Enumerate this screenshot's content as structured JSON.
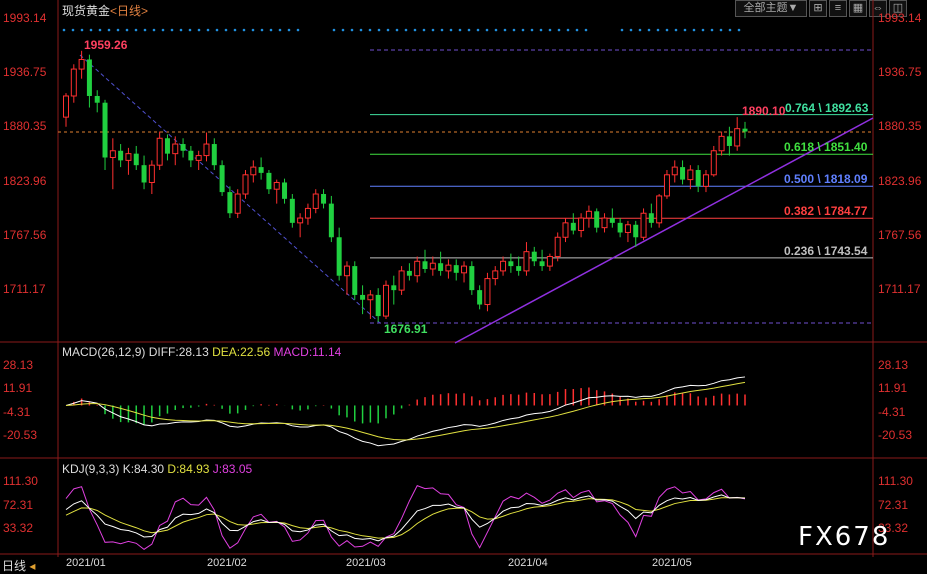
{
  "header": {
    "instrument": "现货黄金",
    "period": "<日线>",
    "theme_button": "全部主题",
    "theme_arrow": "▼",
    "icon_labels": [
      "⊞",
      "≡",
      "▦",
      "⇔",
      "◫"
    ]
  },
  "price_axis": {
    "ticks": [
      "1993.14",
      "1936.75",
      "1880.35",
      "1823.96",
      "1767.56",
      "1711.17"
    ],
    "tick_values": [
      1993.14,
      1936.75,
      1880.35,
      1823.96,
      1767.56,
      1711.17
    ]
  },
  "annotations": {
    "high_label": "1959.26",
    "low_label": "1676.91",
    "recent_high_label": "1890.10"
  },
  "fib_levels": [
    {
      "ratio": "0.764",
      "value": "1892.63",
      "label": "0.764 \\ 1892.63",
      "color": "#40e0a0"
    },
    {
      "ratio": "0.618",
      "value": "1851.40",
      "label": "0.618 \\ 1851.40",
      "color": "#40e040"
    },
    {
      "ratio": "0.500",
      "value": "1818.09",
      "label": "0.500 \\ 1818.09",
      "color": "#6080ff"
    },
    {
      "ratio": "0.382",
      "value": "1784.77",
      "label": "0.382 \\ 1784.77",
      "color": "#ff4040"
    },
    {
      "ratio": "0.236",
      "value": "1743.54",
      "label": "0.236 \\ 1743.54",
      "color": "#c0c0c0"
    }
  ],
  "macd": {
    "label": "MACD(26,12,9)",
    "diff": "DIFF:28.13",
    "dea": "DEA:22.56",
    "macd": "MACD:11.14",
    "ticks": [
      "28.13",
      "11.91",
      "-4.31",
      "-20.53"
    ]
  },
  "kdj": {
    "label": "KDJ(9,3,3)",
    "k": "K:84.30",
    "d": "D:84.93",
    "j": "J:83.05",
    "ticks": [
      "111.30",
      "72.31",
      "33.32"
    ]
  },
  "x_axis": {
    "period_label": "日线",
    "ticks": [
      "2021/01",
      "2021/02",
      "2021/03",
      "2021/04",
      "2021/05"
    ]
  },
  "watermark": "FX678",
  "chart_data": {
    "type": "candlestick",
    "title": "现货黄金",
    "ylim": [
      1670,
      1995
    ],
    "candles": [
      {
        "o": 1890,
        "h": 1915,
        "l": 1880,
        "c": 1912
      },
      {
        "o": 1912,
        "h": 1945,
        "l": 1905,
        "c": 1940
      },
      {
        "o": 1940,
        "h": 1959,
        "l": 1930,
        "c": 1950
      },
      {
        "o": 1950,
        "h": 1955,
        "l": 1900,
        "c": 1912
      },
      {
        "o": 1912,
        "h": 1918,
        "l": 1895,
        "c": 1905
      },
      {
        "o": 1905,
        "h": 1908,
        "l": 1835,
        "c": 1848
      },
      {
        "o": 1848,
        "h": 1868,
        "l": 1815,
        "c": 1855
      },
      {
        "o": 1855,
        "h": 1862,
        "l": 1838,
        "c": 1845
      },
      {
        "o": 1845,
        "h": 1858,
        "l": 1830,
        "c": 1852
      },
      {
        "o": 1852,
        "h": 1860,
        "l": 1835,
        "c": 1840
      },
      {
        "o": 1840,
        "h": 1850,
        "l": 1815,
        "c": 1822
      },
      {
        "o": 1822,
        "h": 1845,
        "l": 1810,
        "c": 1840
      },
      {
        "o": 1840,
        "h": 1875,
        "l": 1835,
        "c": 1868
      },
      {
        "o": 1868,
        "h": 1872,
        "l": 1845,
        "c": 1852
      },
      {
        "o": 1852,
        "h": 1870,
        "l": 1840,
        "c": 1862
      },
      {
        "o": 1862,
        "h": 1868,
        "l": 1848,
        "c": 1855
      },
      {
        "o": 1855,
        "h": 1860,
        "l": 1838,
        "c": 1845
      },
      {
        "o": 1845,
        "h": 1855,
        "l": 1835,
        "c": 1850
      },
      {
        "o": 1850,
        "h": 1874,
        "l": 1844,
        "c": 1862
      },
      {
        "o": 1862,
        "h": 1868,
        "l": 1835,
        "c": 1840
      },
      {
        "o": 1840,
        "h": 1845,
        "l": 1808,
        "c": 1812
      },
      {
        "o": 1812,
        "h": 1818,
        "l": 1785,
        "c": 1790
      },
      {
        "o": 1790,
        "h": 1815,
        "l": 1785,
        "c": 1810
      },
      {
        "o": 1810,
        "h": 1835,
        "l": 1805,
        "c": 1830
      },
      {
        "o": 1830,
        "h": 1845,
        "l": 1822,
        "c": 1838
      },
      {
        "o": 1838,
        "h": 1848,
        "l": 1825,
        "c": 1832
      },
      {
        "o": 1832,
        "h": 1835,
        "l": 1810,
        "c": 1815
      },
      {
        "o": 1815,
        "h": 1825,
        "l": 1800,
        "c": 1822
      },
      {
        "o": 1822,
        "h": 1826,
        "l": 1800,
        "c": 1805
      },
      {
        "o": 1805,
        "h": 1810,
        "l": 1775,
        "c": 1780
      },
      {
        "o": 1780,
        "h": 1790,
        "l": 1765,
        "c": 1785
      },
      {
        "o": 1785,
        "h": 1800,
        "l": 1778,
        "c": 1795
      },
      {
        "o": 1795,
        "h": 1815,
        "l": 1790,
        "c": 1810
      },
      {
        "o": 1810,
        "h": 1815,
        "l": 1795,
        "c": 1800
      },
      {
        "o": 1800,
        "h": 1808,
        "l": 1760,
        "c": 1765
      },
      {
        "o": 1765,
        "h": 1775,
        "l": 1720,
        "c": 1725
      },
      {
        "o": 1725,
        "h": 1740,
        "l": 1705,
        "c": 1735
      },
      {
        "o": 1735,
        "h": 1740,
        "l": 1700,
        "c": 1705
      },
      {
        "o": 1705,
        "h": 1715,
        "l": 1685,
        "c": 1700
      },
      {
        "o": 1700,
        "h": 1710,
        "l": 1680,
        "c": 1705
      },
      {
        "o": 1705,
        "h": 1712,
        "l": 1677,
        "c": 1683
      },
      {
        "o": 1683,
        "h": 1720,
        "l": 1680,
        "c": 1715
      },
      {
        "o": 1715,
        "h": 1725,
        "l": 1695,
        "c": 1710
      },
      {
        "o": 1710,
        "h": 1735,
        "l": 1705,
        "c": 1730
      },
      {
        "o": 1730,
        "h": 1738,
        "l": 1720,
        "c": 1725
      },
      {
        "o": 1725,
        "h": 1745,
        "l": 1718,
        "c": 1740
      },
      {
        "o": 1740,
        "h": 1752,
        "l": 1728,
        "c": 1732
      },
      {
        "o": 1732,
        "h": 1745,
        "l": 1725,
        "c": 1738
      },
      {
        "o": 1738,
        "h": 1750,
        "l": 1725,
        "c": 1730
      },
      {
        "o": 1730,
        "h": 1742,
        "l": 1722,
        "c": 1736
      },
      {
        "o": 1736,
        "h": 1742,
        "l": 1720,
        "c": 1728
      },
      {
        "o": 1728,
        "h": 1740,
        "l": 1718,
        "c": 1735
      },
      {
        "o": 1735,
        "h": 1740,
        "l": 1705,
        "c": 1710
      },
      {
        "o": 1710,
        "h": 1715,
        "l": 1690,
        "c": 1695
      },
      {
        "o": 1695,
        "h": 1728,
        "l": 1688,
        "c": 1722
      },
      {
        "o": 1722,
        "h": 1735,
        "l": 1715,
        "c": 1730
      },
      {
        "o": 1730,
        "h": 1745,
        "l": 1725,
        "c": 1740
      },
      {
        "o": 1740,
        "h": 1748,
        "l": 1728,
        "c": 1735
      },
      {
        "o": 1735,
        "h": 1745,
        "l": 1725,
        "c": 1730
      },
      {
        "o": 1730,
        "h": 1760,
        "l": 1725,
        "c": 1750
      },
      {
        "o": 1750,
        "h": 1755,
        "l": 1735,
        "c": 1740
      },
      {
        "o": 1740,
        "h": 1752,
        "l": 1730,
        "c": 1735
      },
      {
        "o": 1735,
        "h": 1748,
        "l": 1730,
        "c": 1745
      },
      {
        "o": 1745,
        "h": 1770,
        "l": 1740,
        "c": 1765
      },
      {
        "o": 1765,
        "h": 1785,
        "l": 1760,
        "c": 1780
      },
      {
        "o": 1780,
        "h": 1790,
        "l": 1768,
        "c": 1772
      },
      {
        "o": 1772,
        "h": 1790,
        "l": 1765,
        "c": 1785
      },
      {
        "o": 1785,
        "h": 1798,
        "l": 1775,
        "c": 1792
      },
      {
        "o": 1792,
        "h": 1795,
        "l": 1770,
        "c": 1775
      },
      {
        "o": 1775,
        "h": 1790,
        "l": 1770,
        "c": 1785
      },
      {
        "o": 1785,
        "h": 1795,
        "l": 1775,
        "c": 1780
      },
      {
        "o": 1780,
        "h": 1785,
        "l": 1765,
        "c": 1770
      },
      {
        "o": 1770,
        "h": 1782,
        "l": 1760,
        "c": 1778
      },
      {
        "o": 1778,
        "h": 1782,
        "l": 1755,
        "c": 1765
      },
      {
        "o": 1765,
        "h": 1795,
        "l": 1762,
        "c": 1790
      },
      {
        "o": 1790,
        "h": 1800,
        "l": 1775,
        "c": 1780
      },
      {
        "o": 1780,
        "h": 1810,
        "l": 1775,
        "c": 1808
      },
      {
        "o": 1808,
        "h": 1835,
        "l": 1805,
        "c": 1830
      },
      {
        "o": 1830,
        "h": 1845,
        "l": 1822,
        "c": 1838
      },
      {
        "o": 1838,
        "h": 1845,
        "l": 1820,
        "c": 1825
      },
      {
        "o": 1825,
        "h": 1840,
        "l": 1815,
        "c": 1835
      },
      {
        "o": 1835,
        "h": 1840,
        "l": 1812,
        "c": 1818
      },
      {
        "o": 1818,
        "h": 1835,
        "l": 1812,
        "c": 1830
      },
      {
        "o": 1830,
        "h": 1860,
        "l": 1828,
        "c": 1855
      },
      {
        "o": 1855,
        "h": 1875,
        "l": 1850,
        "c": 1870
      },
      {
        "o": 1870,
        "h": 1880,
        "l": 1850,
        "c": 1860
      },
      {
        "o": 1860,
        "h": 1890,
        "l": 1855,
        "c": 1878
      },
      {
        "o": 1878,
        "h": 1885,
        "l": 1868,
        "c": 1875
      }
    ]
  }
}
